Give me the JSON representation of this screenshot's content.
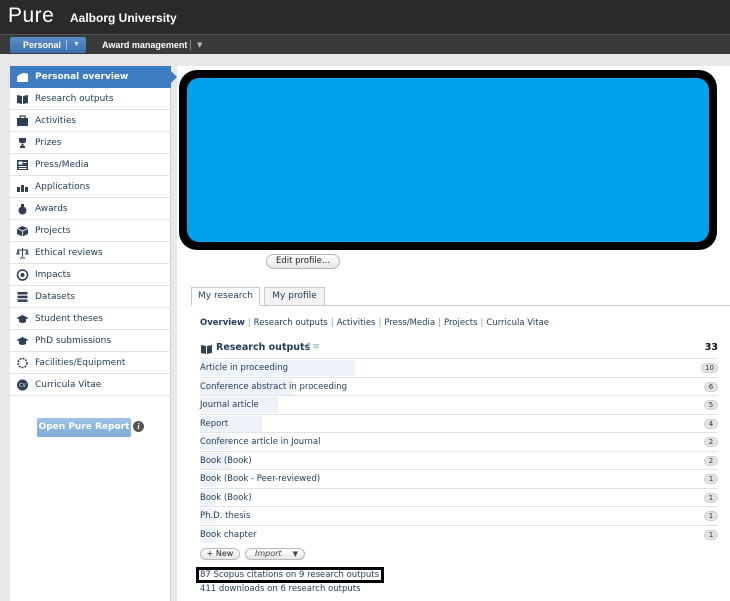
{
  "header": {
    "logo": "Pure",
    "organization": "Aalborg University"
  },
  "nav": {
    "personal": "Personal",
    "award_management": "Award management"
  },
  "sidebar": {
    "items": [
      {
        "label": "Personal overview",
        "icon": "personal-overview-icon",
        "active": true
      },
      {
        "label": "Research outputs",
        "icon": "book-icon"
      },
      {
        "label": "Activities",
        "icon": "briefcase-icon"
      },
      {
        "label": "Prizes",
        "icon": "trophy-icon"
      },
      {
        "label": "Press/Media",
        "icon": "newspaper-icon"
      },
      {
        "label": "Applications",
        "icon": "applications-icon"
      },
      {
        "label": "Awards",
        "icon": "money-bag-icon"
      },
      {
        "label": "Projects",
        "icon": "cube-icon"
      },
      {
        "label": "Ethical reviews",
        "icon": "scales-icon"
      },
      {
        "label": "Impacts",
        "icon": "impact-icon"
      },
      {
        "label": "Datasets",
        "icon": "database-icon"
      },
      {
        "label": "Student theses",
        "icon": "graduation-cap-icon"
      },
      {
        "label": "PhD submissions",
        "icon": "graduation-cap-icon"
      },
      {
        "label": "Facilities/Equipment",
        "icon": "facilities-icon"
      },
      {
        "label": "Curricula Vitae",
        "icon": "cv-icon"
      }
    ],
    "open_report": "Open Pure Report"
  },
  "main": {
    "edit_profile": "Edit profile...",
    "tabs": [
      "My research",
      "My profile"
    ],
    "subnav": [
      "Overview",
      "Research outputs",
      "Activities",
      "Press/Media",
      "Projects",
      "Curricula Vitae"
    ],
    "research_outputs": {
      "title": "Research outputs",
      "total": "33",
      "rows": [
        {
          "label": "Article in proceeding",
          "count": 10
        },
        {
          "label": "Conference abstract in proceeding",
          "count": 6
        },
        {
          "label": "Journal article",
          "count": 5
        },
        {
          "label": "Report",
          "count": 4
        },
        {
          "label": "Conference article in Journal",
          "count": 2
        },
        {
          "label": "Book (Book)",
          "count": 2
        },
        {
          "label": "Book (Book - Peer-reviewed)",
          "count": 1
        },
        {
          "label": "Book (Book)",
          "count": 1
        },
        {
          "label": "Ph.D. thesis",
          "count": 1
        },
        {
          "label": "Book chapter",
          "count": 1
        }
      ]
    },
    "new_button": "New",
    "import_button": "Import",
    "scopus": "87 Scopus citations on 9 research outputs",
    "downloads": "411 downloads on 6 research outputs"
  },
  "colors": {
    "accent": "#3e7cc2",
    "profile_fill": "#00a2ed"
  }
}
